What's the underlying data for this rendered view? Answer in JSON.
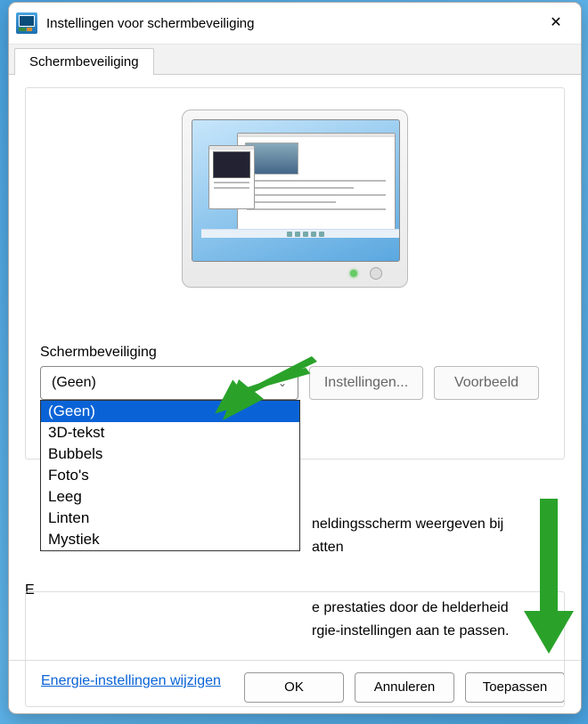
{
  "window_title": "Instellingen voor schermbeveiliging",
  "tab": {
    "label": "Schermbeveiliging"
  },
  "section": {
    "label": "Schermbeveiliging"
  },
  "dropdown": {
    "selected": "(Geen)",
    "options": [
      "(Geen)",
      "3D-tekst",
      "Bubbels",
      "Foto's",
      "Leeg",
      "Linten",
      "Mystiek"
    ]
  },
  "buttons": {
    "settings": "Instellingen...",
    "preview": "Voorbeeld"
  },
  "logon_text_line1": "neldingsscherm weergeven bij",
  "logon_text_line2": "atten",
  "energy_section_letter": "E",
  "energy_text_line1": "e prestaties door de helderheid",
  "energy_text_line2": "rgie-instellingen aan te passen.",
  "energy_link": "Energie-instellingen wijzigen",
  "footer": {
    "ok": "OK",
    "cancel": "Annuleren",
    "apply": "Toepassen"
  }
}
